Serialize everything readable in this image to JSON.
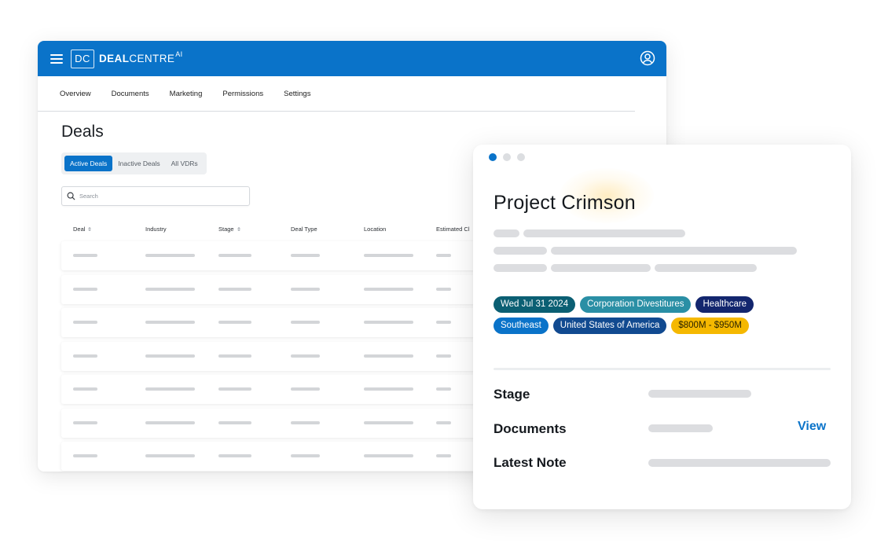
{
  "app": {
    "logo_mark": "DC",
    "logo_bold": "DEAL",
    "logo_light": "CENTRE",
    "logo_sup": "AI"
  },
  "nav": {
    "items": [
      {
        "label": "Overview"
      },
      {
        "label": "Documents"
      },
      {
        "label": "Marketing"
      },
      {
        "label": "Permissions"
      },
      {
        "label": "Settings"
      }
    ]
  },
  "deals": {
    "title": "Deals",
    "tabs": [
      {
        "label": "Active Deals",
        "active": true
      },
      {
        "label": "Inactive Deals",
        "active": false
      },
      {
        "label": "All VDRs",
        "active": false
      }
    ],
    "search_placeholder": "Search",
    "columns": [
      {
        "label": "Deal",
        "sortable": true
      },
      {
        "label": "Industry",
        "sortable": false
      },
      {
        "label": "Stage",
        "sortable": true
      },
      {
        "label": "Deal Type",
        "sortable": false
      },
      {
        "label": "Location",
        "sortable": false
      },
      {
        "label": "Estimated Cl",
        "sortable": false
      }
    ],
    "row_count": 7
  },
  "card": {
    "title": "Project Crimson",
    "tags": [
      [
        {
          "label": "Wed Jul 31 2024",
          "color": "#0b5f73"
        },
        {
          "label": "Corporation Divestitures",
          "color": "#2a8fa5"
        },
        {
          "label": "Healthcare",
          "color": "#13266e"
        }
      ],
      [
        {
          "label": "Southeast",
          "color": "#0a73c9"
        },
        {
          "label": "United States of America",
          "color": "#114a90"
        },
        {
          "label": "$800M - $950M",
          "color": "#f5b800",
          "text_color": "#2a2300"
        }
      ]
    ],
    "details": {
      "stage_label": "Stage",
      "documents_label": "Documents",
      "latest_note_label": "Latest Note",
      "view_link": "View"
    }
  },
  "colors": {
    "brand_blue": "#0a73c9",
    "skeleton": "#dcdde0"
  }
}
